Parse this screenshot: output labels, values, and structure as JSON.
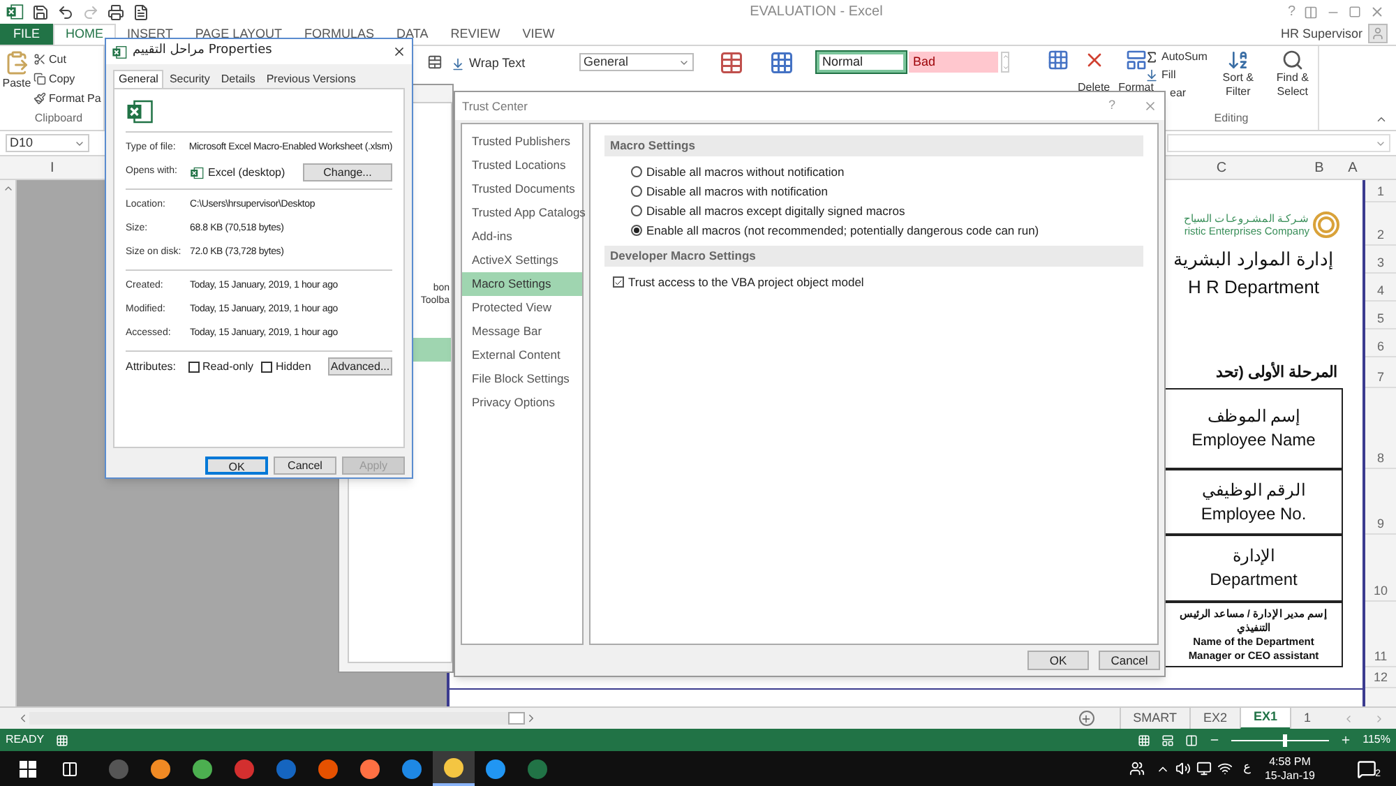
{
  "app": {
    "title": "EVALUATION - Excel",
    "help": "?",
    "user": "HR Supervisor"
  },
  "ribbon_tabs": [
    {
      "label": "FILE",
      "kind": "file",
      "selected": false
    },
    {
      "label": "HOME",
      "kind": "tab",
      "selected": true
    },
    {
      "label": "INSERT",
      "kind": "tab",
      "selected": false
    },
    {
      "label": "PAGE LAYOUT",
      "kind": "tab",
      "selected": false
    },
    {
      "label": "FORMULAS",
      "kind": "tab",
      "selected": false
    },
    {
      "label": "DATA",
      "kind": "tab",
      "selected": false
    },
    {
      "label": "REVIEW",
      "kind": "tab",
      "selected": false
    },
    {
      "label": "VIEW",
      "kind": "tab",
      "selected": false
    }
  ],
  "ribbon": {
    "paste": "Paste",
    "clipboard_items": [
      "Cut",
      "Copy",
      "Format Pa"
    ],
    "clipboard_label": "Clipboard",
    "wrap_text": "Wrap Text",
    "number_format": "General",
    "styles": [
      {
        "label": "Normal",
        "kind": "normal",
        "selected": true
      },
      {
        "label": "Bad",
        "kind": "bad",
        "selected": false
      }
    ],
    "cells": [
      "Delete",
      "Format"
    ],
    "editing": {
      "autosum": "AutoSum",
      "fill": "Fill",
      "clear": "ear",
      "sort": "Sort & Filter",
      "find": "Find & Select",
      "label": "Editing"
    }
  },
  "formula_bar": {
    "name_box": "D10"
  },
  "sheet": {
    "left_column_header": "I",
    "column_headers": [
      "C",
      "B",
      "A"
    ],
    "rows": [
      {
        "number": "1",
        "kind": "blank"
      },
      {
        "number": "2",
        "kind": "logo",
        "lines": [
          "شـركـة المشـروعـات السياح",
          "ristic Enterprises Company"
        ]
      },
      {
        "number": "3",
        "kind": "title",
        "lines": [
          "إدارة الموارد البشرية"
        ]
      },
      {
        "number": "4",
        "kind": "title",
        "lines": [
          "H R Department"
        ]
      },
      {
        "number": "5",
        "kind": "blank"
      },
      {
        "number": "6",
        "kind": "blank"
      },
      {
        "number": "7",
        "kind": "heading",
        "lines": [
          "المرحلة الأولى (تحد"
        ]
      },
      {
        "number": "8",
        "kind": "field",
        "lines": [
          "إسم الموظف",
          "Employee Name"
        ]
      },
      {
        "number": "9",
        "kind": "field",
        "lines": [
          "الرقم الوظيفي",
          "Employee No."
        ]
      },
      {
        "number": "10",
        "kind": "field",
        "lines": [
          "الإدارة",
          "Department"
        ]
      },
      {
        "number": "11",
        "kind": "field_small",
        "lines": [
          "إسم مدير الإدارة / مساعد الرئيس",
          "التنفيذي",
          "Name of the Department",
          "Manager or CEO assistant"
        ]
      },
      {
        "number": "12",
        "kind": "blank"
      }
    ]
  },
  "sheet_tabs": [
    {
      "label": "SMART",
      "selected": false
    },
    {
      "label": "EX2",
      "selected": false
    },
    {
      "label": "EX1",
      "selected": true
    },
    {
      "label": "1",
      "selected": false
    }
  ],
  "status_bar": {
    "status": "READY",
    "zoom": {
      "level": 0.52
    },
    "zoom_reading": "115%"
  },
  "taskbar": {
    "language": "ع",
    "time": "4:58 PM",
    "date": "15-Jan-19",
    "notifications": "2"
  },
  "options_window": {
    "nav_items": [
      {
        "label": "bon",
        "selected": false
      },
      {
        "label": "Toolba",
        "selected": false
      },
      {
        "selected": true
      }
    ]
  },
  "properties_dialog": {
    "title": "مراحل التقييم Properties",
    "tabs": [
      {
        "label": "General",
        "selected": true
      },
      {
        "label": "Security",
        "selected": false
      },
      {
        "label": "Details",
        "selected": false
      },
      {
        "label": "Previous Versions",
        "selected": false
      }
    ],
    "sections": [
      [
        {
          "label": "Type of file:",
          "value": "Microsoft Excel Macro-Enabled Worksheet (.xlsm)",
          "kind": "text"
        },
        {
          "label": "Opens with:",
          "value": "Excel (desktop)",
          "kind": "app",
          "button": "Change..."
        }
      ],
      [
        {
          "label": "Location:",
          "value": "C:\\Users\\hrsupervisor\\Desktop",
          "kind": "text"
        },
        {
          "label": "Size:",
          "value": "68.8 KB (70,518 bytes)",
          "kind": "text"
        },
        {
          "label": "Size on disk:",
          "value": "72.0 KB (73,728 bytes)",
          "kind": "text"
        }
      ],
      [
        {
          "label": "Created:",
          "value": "Today, 15 January, 2019, 1 hour ago",
          "kind": "text"
        },
        {
          "label": "Modified:",
          "value": "Today, 15 January, 2019, 1 hour ago",
          "kind": "text"
        },
        {
          "label": "Accessed:",
          "value": "Today, 15 January, 2019, 1 hour ago",
          "kind": "text"
        }
      ]
    ],
    "attributes": {
      "label": "Attributes:",
      "checkboxes": [
        {
          "label": "Read-only",
          "checked": false
        },
        {
          "label": "Hidden",
          "checked": false
        }
      ],
      "button": "Advanced..."
    },
    "buttons": [
      {
        "label": "OK",
        "default": true,
        "disabled": false
      },
      {
        "label": "Cancel",
        "default": false,
        "disabled": false
      },
      {
        "label": "Apply",
        "default": false,
        "disabled": true
      }
    ]
  },
  "trust_center": {
    "title": "Trust Center",
    "help": "?",
    "nav": [
      {
        "label": "Trusted Publishers",
        "selected": false
      },
      {
        "label": "Trusted Locations",
        "selected": false
      },
      {
        "label": "Trusted Documents",
        "selected": false
      },
      {
        "label": "Trusted App Catalogs",
        "selected": false
      },
      {
        "label": "Add-ins",
        "selected": false
      },
      {
        "label": "ActiveX Settings",
        "selected": false
      },
      {
        "label": "Macro Settings",
        "selected": true
      },
      {
        "label": "Protected View",
        "selected": false
      },
      {
        "label": "Message Bar",
        "selected": false
      },
      {
        "label": "External Content",
        "selected": false
      },
      {
        "label": "File Block Settings",
        "selected": false
      },
      {
        "label": "Privacy Options",
        "selected": false
      }
    ],
    "sections": [
      {
        "heading": "Macro Settings",
        "kind": "radio",
        "options": [
          {
            "label": "Disable all macros without notification",
            "selected": false
          },
          {
            "label": "Disable all macros with notification",
            "selected": false
          },
          {
            "label": "Disable all macros except digitally signed macros",
            "selected": false
          },
          {
            "label": "Enable all macros (not recommended; potentially dangerous code can run)",
            "selected": true
          }
        ]
      },
      {
        "heading": "Developer Macro Settings",
        "kind": "checkbox",
        "options": [
          {
            "label": "Trust access to the VBA project object model",
            "checked": true
          }
        ]
      }
    ],
    "buttons": [
      "OK",
      "Cancel"
    ]
  }
}
